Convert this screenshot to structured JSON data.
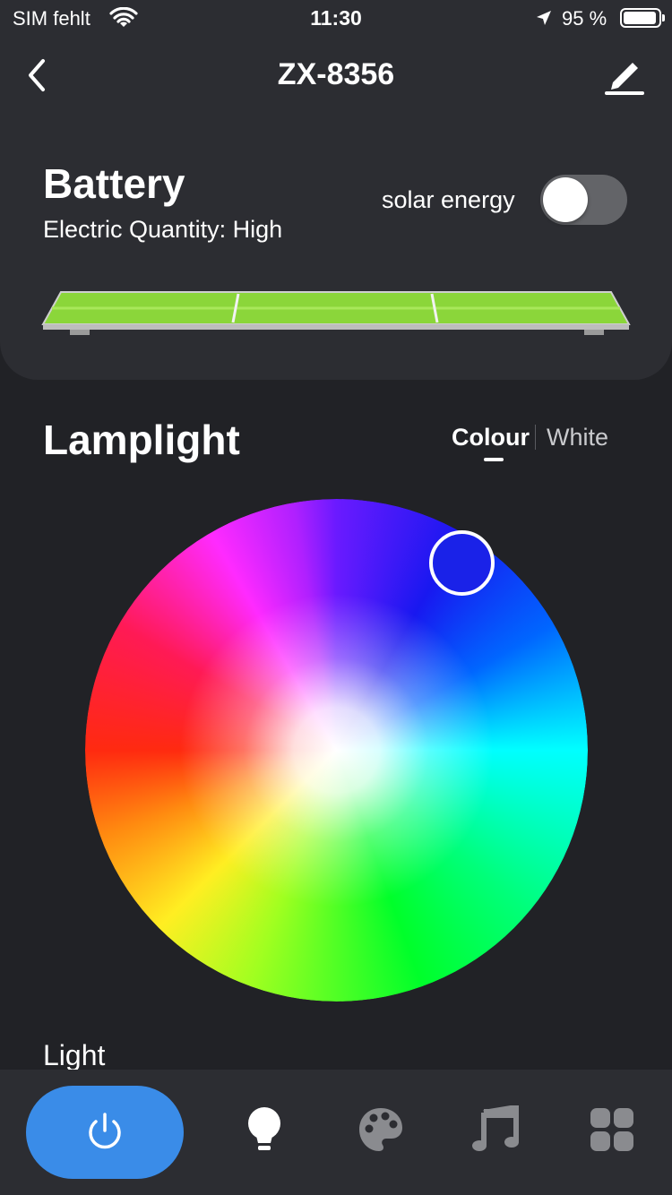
{
  "status_bar": {
    "carrier": "SIM fehlt",
    "time": "11:30",
    "battery_percent": "95 %"
  },
  "nav": {
    "title": "ZX-8356",
    "back_icon": "chevron-left-icon",
    "edit_icon": "pencil-icon"
  },
  "battery": {
    "title": "Battery",
    "subtitle": "Electric Quantity: High",
    "solar_label": "solar energy",
    "solar_enabled": false,
    "panel_color": "#8bd63a"
  },
  "lamplight": {
    "title": "Lamplight",
    "tabs": [
      "Colour",
      "White"
    ],
    "active_tab": "Colour",
    "selected_color": "#1a22e8",
    "light_label": "Light"
  },
  "bottom_nav": {
    "items": [
      {
        "icon": "power-icon",
        "active": true
      },
      {
        "icon": "bulb-icon",
        "active": false
      },
      {
        "icon": "palette-icon",
        "active": false
      },
      {
        "icon": "music-icon",
        "active": false
      },
      {
        "icon": "grid-icon",
        "active": false
      }
    ],
    "accent": "#3a8ce8"
  }
}
